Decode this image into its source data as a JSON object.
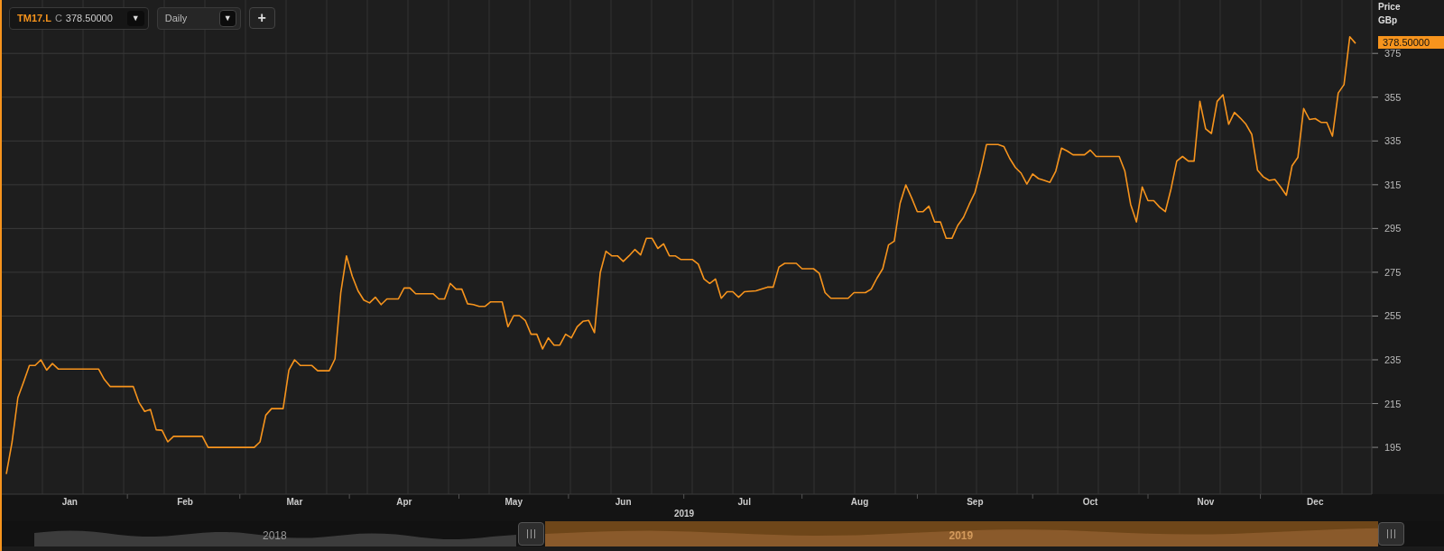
{
  "toolbar": {
    "price_prefix": "C",
    "price": "378.50000",
    "symbol_dropdown": "▼",
    "interval": "Daily",
    "interval_dropdown": "▼",
    "add_button": "+"
  },
  "axis": {
    "title": "Price",
    "unit": "GBp",
    "last_price": "378.50000"
  },
  "chart_data": {
    "type": "line",
    "grid": true,
    "ylim": [
      173.6,
      399.4
    ],
    "yticks": [
      195,
      215,
      235,
      255,
      275,
      295,
      315,
      335,
      355,
      375
    ],
    "categories": [
      null,
      null,
      null,
      null,
      null,
      null,
      null,
      null,
      null,
      null,
      null,
      "Jan",
      null,
      null,
      null,
      null,
      null,
      null,
      null,
      null,
      null,
      null,
      null,
      null,
      null,
      null,
      null,
      null,
      null,
      null,
      null,
      "Feb",
      null,
      null,
      null,
      null,
      null,
      null,
      null,
      null,
      null,
      null,
      null,
      null,
      null,
      null,
      null,
      null,
      null,
      null,
      "Mar",
      null,
      null,
      null,
      null,
      null,
      null,
      null,
      null,
      null,
      null,
      null,
      null,
      null,
      null,
      null,
      null,
      null,
      null,
      "Apr",
      null,
      null,
      null,
      null,
      null,
      null,
      null,
      null,
      null,
      null,
      null,
      null,
      null,
      null,
      null,
      null,
      null,
      null,
      "May",
      null,
      null,
      null,
      null,
      null,
      null,
      null,
      null,
      null,
      null,
      null,
      null,
      null,
      null,
      null,
      null,
      null,
      null,
      "Jun",
      null,
      null,
      null,
      null,
      null,
      null,
      null,
      null,
      null,
      null,
      null,
      null,
      null,
      null,
      null,
      null,
      null,
      null,
      null,
      null,
      "Jul",
      null,
      null,
      null,
      null,
      null,
      null,
      null,
      null,
      null,
      null,
      null,
      null,
      null,
      null,
      null,
      null,
      null,
      null,
      null,
      "Aug",
      null,
      null,
      null,
      null,
      null,
      null,
      null,
      null,
      null,
      null,
      null,
      null,
      null,
      null,
      null,
      null,
      null,
      null,
      null,
      "Sep",
      null,
      null,
      null,
      null,
      null,
      null,
      null,
      null,
      null,
      null,
      null,
      null,
      null,
      null,
      null,
      null,
      null,
      null,
      null,
      "Oct",
      null,
      null,
      null,
      null,
      null,
      null,
      null,
      null,
      null,
      null,
      null,
      null,
      null,
      null,
      null,
      null,
      null,
      null,
      null,
      "Nov",
      null,
      null,
      null,
      null,
      null,
      null,
      null,
      null,
      null,
      null,
      null,
      null,
      null,
      null,
      null,
      null,
      null,
      null,
      "Dec",
      null,
      null,
      null,
      null,
      null,
      null,
      null
    ],
    "series": [
      {
        "name": "TM17.L",
        "color": "#f7941d",
        "values": [
          182.8,
          197.5,
          217.7,
          224.9,
          232.4,
          232.4,
          235,
          230.3,
          233.3,
          230.8,
          230.8,
          230.8,
          230.8,
          230.8,
          230.8,
          230.8,
          230.8,
          226,
          222.8,
          222.8,
          222.8,
          222.8,
          222.8,
          215.6,
          211.4,
          212.3,
          203,
          202.8,
          197.5,
          200,
          200,
          200,
          200,
          200,
          200,
          195,
          195,
          195,
          195,
          195,
          195,
          195,
          195,
          195,
          197.5,
          209.7,
          212.7,
          212.7,
          212.7,
          230.3,
          235,
          232.4,
          232.4,
          232.4,
          230,
          230,
          230,
          235.4,
          265.7,
          282.5,
          273.2,
          266.5,
          262.3,
          261,
          263.6,
          260.2,
          262.8,
          262.8,
          262.8,
          267.8,
          267.8,
          265.2,
          265.2,
          265.2,
          265.2,
          262.8,
          262.8,
          269.9,
          267.3,
          267.3,
          260.6,
          260.2,
          259.4,
          259.4,
          261.5,
          261.5,
          261.5,
          250.1,
          255.2,
          255.2,
          253,
          246.7,
          246.7,
          240,
          245,
          241.7,
          241.7,
          246.7,
          245,
          250.1,
          252.6,
          253,
          247.4,
          274.9,
          284.6,
          282.5,
          282.5,
          280,
          282.5,
          285.4,
          282.9,
          290.5,
          290.5,
          285.9,
          288,
          282.5,
          282.5,
          280.8,
          280.8,
          280.8,
          278.7,
          271.9,
          269.9,
          271.9,
          263.1,
          266.1,
          266.1,
          263.6,
          266.1,
          266.3,
          266.5,
          267.4,
          268.2,
          268.2,
          277.4,
          279.1,
          279.1,
          279.1,
          276.6,
          276.6,
          276.6,
          274.5,
          265.7,
          263.1,
          263.1,
          263.1,
          263.1,
          265.7,
          265.7,
          265.7,
          267.3,
          272.3,
          276.6,
          287.5,
          289.2,
          306.5,
          314.9,
          309,
          302.7,
          302.7,
          305.2,
          298,
          298,
          290.5,
          290.5,
          296.4,
          300.1,
          306,
          311.5,
          321.6,
          333.4,
          333.4,
          333.4,
          332.5,
          327.1,
          322.9,
          320.3,
          315.3,
          319.9,
          317.8,
          317,
          316.1,
          321.2,
          331.7,
          330.4,
          328.7,
          328.7,
          328.7,
          330.8,
          327.9,
          327.9,
          327.9,
          327.9,
          327.9,
          321.2,
          306,
          298,
          314,
          307.7,
          307.7,
          304.8,
          302.7,
          313.2,
          325.8,
          327.9,
          325.8,
          325.8,
          353.1,
          340.5,
          338.4,
          353.1,
          356.1,
          342.6,
          348,
          345.5,
          342.6,
          338,
          321.6,
          318.6,
          317,
          317.4,
          314,
          310.2,
          323.7,
          327.5,
          349.8,
          344.8,
          345.2,
          343.5,
          343.5,
          337.2,
          356.9,
          360.7,
          382.6,
          379.6
        ]
      }
    ]
  },
  "year_label": "2019",
  "navigator": {
    "periods": [
      {
        "label": "2018",
        "selected": false
      },
      {
        "label": "2019",
        "selected": true
      }
    ]
  }
}
